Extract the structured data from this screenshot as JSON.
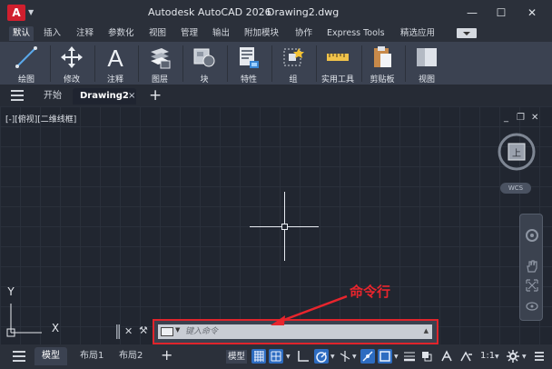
{
  "app": {
    "logo_letter": "A",
    "title": "Autodesk AutoCAD 2026",
    "filename": "Drawing2.dwg"
  },
  "window_controls": {
    "minimize": "—",
    "maximize": "☐",
    "close": "✕"
  },
  "ribbon_tabs": [
    "默认",
    "插入",
    "注释",
    "参数化",
    "视图",
    "管理",
    "输出",
    "附加模块",
    "协作",
    "Express Tools",
    "精选应用"
  ],
  "ribbon_buttons": [
    "绘图",
    "修改",
    "注释",
    "图层",
    "块",
    "特性",
    "组",
    "实用工具",
    "剪贴板",
    "视图"
  ],
  "file_tabs": {
    "start": "开始",
    "drawing": "Drawing2",
    "close": "×",
    "add": "+"
  },
  "viewport": {
    "label": "[-][俯视][二维线框]",
    "ctrl_min": "_",
    "ctrl_restore": "❐",
    "ctrl_close": "✕"
  },
  "viewcube": {
    "face": "上",
    "wcs": "WCS"
  },
  "ucs": {
    "x": "X",
    "y": "Y"
  },
  "command_line": {
    "placeholder": "键入命令",
    "close": "✕",
    "wrench": "🔧",
    "annotation": "命令行"
  },
  "layout_tabs": [
    "模型",
    "布局1",
    "布局2"
  ],
  "status": {
    "model": "模型",
    "scale": "1:1",
    "add": "+"
  },
  "colors": {
    "accent_red": "#e0242b",
    "active_blue": "#2d6cc1",
    "canvas": "#212630"
  }
}
